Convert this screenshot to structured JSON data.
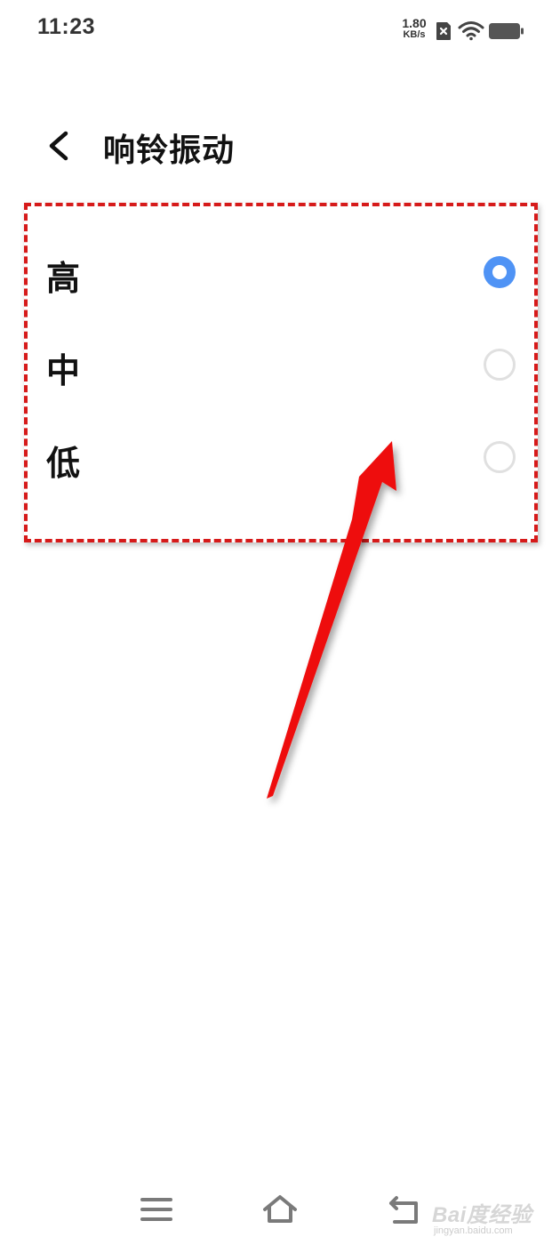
{
  "status_bar": {
    "time": "11:23",
    "net_speed_value": "1.80",
    "net_speed_unit": "KB/s",
    "icons": [
      "sim-disabled-icon",
      "wifi-icon",
      "battery-icon"
    ]
  },
  "header": {
    "back_icon": "chevron-left-icon",
    "title": "响铃振动"
  },
  "options": [
    {
      "label": "高",
      "selected": true
    },
    {
      "label": "中",
      "selected": false
    },
    {
      "label": "低",
      "selected": false
    }
  ],
  "annotation": {
    "box_color": "#d61a1a",
    "arrow_color": "#ee1111"
  },
  "colors": {
    "radio_selected": "#4f93f5",
    "radio_unselected": "#e0e0e0"
  },
  "nav_bar": {
    "icons": [
      "menu-icon",
      "home-icon",
      "back-icon"
    ]
  },
  "watermark": {
    "text": "Bai度经验",
    "sub": "jingyan.baidu.com"
  }
}
